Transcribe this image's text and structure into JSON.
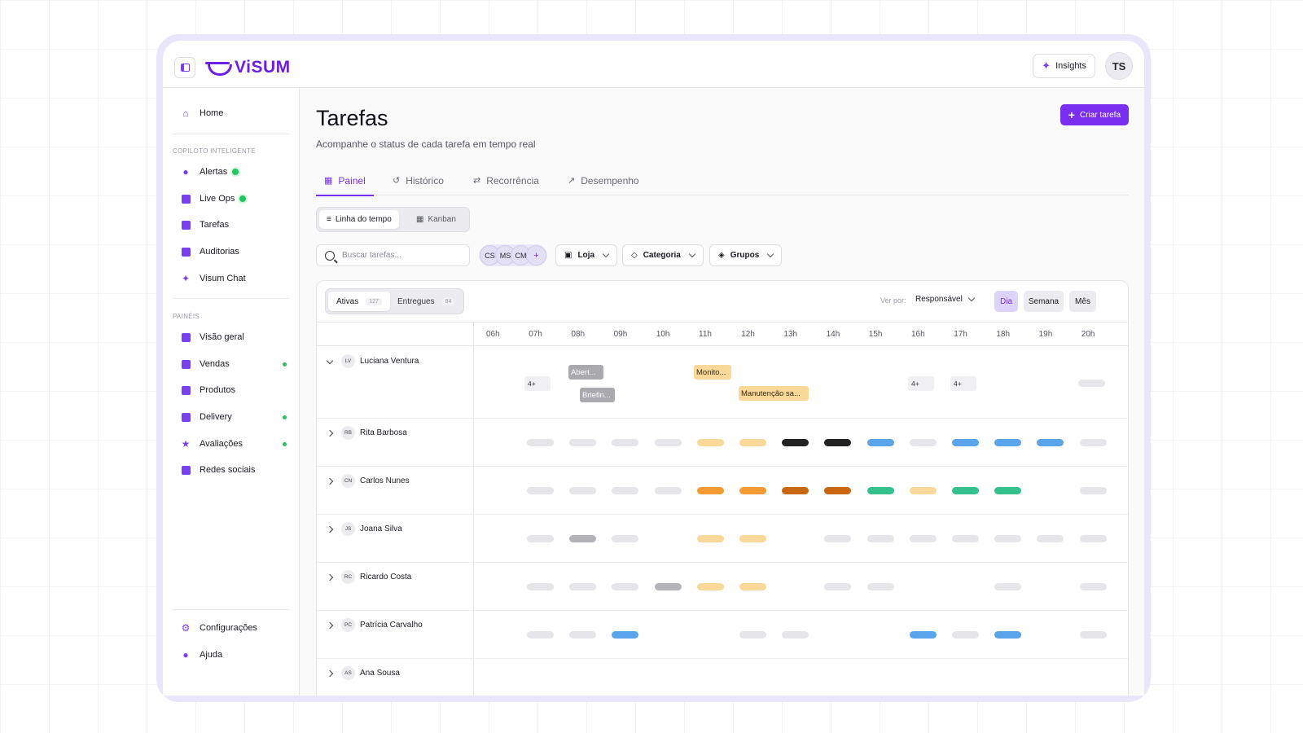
{
  "app": {
    "name": "ViSUM",
    "insights_label": "Insights",
    "user_initials": "TS"
  },
  "sidebar": {
    "top": [
      {
        "label": "Home",
        "icon": "home-icon"
      }
    ],
    "section1_label": "COPILOTO INTELIGENTE",
    "section1": [
      {
        "label": "Alertas",
        "icon": "bell-icon"
      },
      {
        "label": "Live Ops",
        "icon": "pulse-icon"
      },
      {
        "label": "Tarefas",
        "icon": "task-icon"
      },
      {
        "label": "Auditorias",
        "icon": "clipboard-icon"
      },
      {
        "label": "Visum Chat",
        "icon": "sparkle-icon"
      }
    ],
    "section2_label": "PAINÉIS",
    "section2": [
      {
        "label": "Visão geral",
        "icon": "grid-icon"
      },
      {
        "label": "Vendas",
        "icon": "cart-icon"
      },
      {
        "label": "Produtos",
        "icon": "box-icon"
      },
      {
        "label": "Delivery",
        "icon": "bike-icon"
      },
      {
        "label": "Avaliações",
        "icon": "star-icon"
      },
      {
        "label": "Redes sociais",
        "icon": "people-icon"
      }
    ],
    "bottom": [
      {
        "label": "Configurações",
        "icon": "gear-icon"
      },
      {
        "label": "Ajuda",
        "icon": "help-icon"
      }
    ]
  },
  "page": {
    "title": "Tarefas",
    "subtitle": "Acompanhe o status de cada tarefa em tempo real",
    "create_label": "Criar tarefa",
    "tabs": [
      "Painel",
      "Histórico",
      "Recorrência",
      "Desempenho"
    ],
    "views": [
      "Linha do tempo",
      "Kanban"
    ],
    "search_placeholder": "Buscar tarefas...",
    "assignees": [
      "CS",
      "MS",
      "CM",
      "+"
    ],
    "filters": [
      "Loja",
      "Categoria",
      "Grupos"
    ]
  },
  "board": {
    "segments": [
      {
        "label": "Ativas",
        "count": "127"
      },
      {
        "label": "Entregues",
        "count": "84"
      }
    ],
    "view_by_label": "Ver por:",
    "view_by_value": "Responsável",
    "periods": [
      "Dia",
      "Semana",
      "Mês"
    ],
    "hours": [
      "06h",
      "07h",
      "08h",
      "09h",
      "10h",
      "11h",
      "12h",
      "13h",
      "14h",
      "15h",
      "16h",
      "17h",
      "18h",
      "19h",
      "20h"
    ],
    "expanded_events": [
      {
        "label": "4+",
        "hour": "07h",
        "type": "more"
      },
      {
        "label": "Abert...",
        "hour": "08h",
        "type": "gray"
      },
      {
        "label": "Briefin...",
        "hour": "08h",
        "type": "gray"
      },
      {
        "label": "Monito...",
        "hour": "11h",
        "type": "yellow"
      },
      {
        "label": "Manutenção sa...",
        "hour": "12h",
        "type": "yellow"
      },
      {
        "label": "4+",
        "hour": "16h",
        "type": "more"
      },
      {
        "label": "4+",
        "hour": "17h",
        "type": "more"
      }
    ],
    "rows": [
      {
        "initials": "LV",
        "name": "Luciana Ventura",
        "expanded": true
      },
      {
        "initials": "RB",
        "name": "Rita Barbosa",
        "cells": [
          "",
          "g",
          "g",
          "g",
          "g",
          "y",
          "y",
          "k",
          "k",
          "b",
          "g",
          "b",
          "b",
          "b",
          "g"
        ]
      },
      {
        "initials": "CN",
        "name": "Carlos Nunes",
        "cells": [
          "",
          "g",
          "g",
          "g",
          "g",
          "o",
          "o",
          "r",
          "r",
          "t",
          "y",
          "t",
          "t",
          "",
          "g"
        ]
      },
      {
        "initials": "JS",
        "name": "Joana Silva",
        "cells": [
          "",
          "g",
          "d",
          "g",
          "",
          "y",
          "y",
          "",
          "g",
          "g",
          "g",
          "g",
          "g",
          "g",
          "g"
        ]
      },
      {
        "initials": "RC",
        "name": "Ricardo Costa",
        "cells": [
          "",
          "g",
          "g",
          "g",
          "d",
          "y",
          "y",
          "",
          "g",
          "g",
          "",
          "",
          "g",
          "",
          "g"
        ]
      },
      {
        "initials": "PC",
        "name": "Patrícia Carvalho",
        "cells": [
          "",
          "g",
          "g",
          "b",
          "",
          "",
          "g",
          "g",
          "",
          "",
          "b",
          "g",
          "b",
          "",
          "g"
        ]
      },
      {
        "initials": "AS",
        "name": "Ana Sousa",
        "cells": []
      }
    ]
  }
}
